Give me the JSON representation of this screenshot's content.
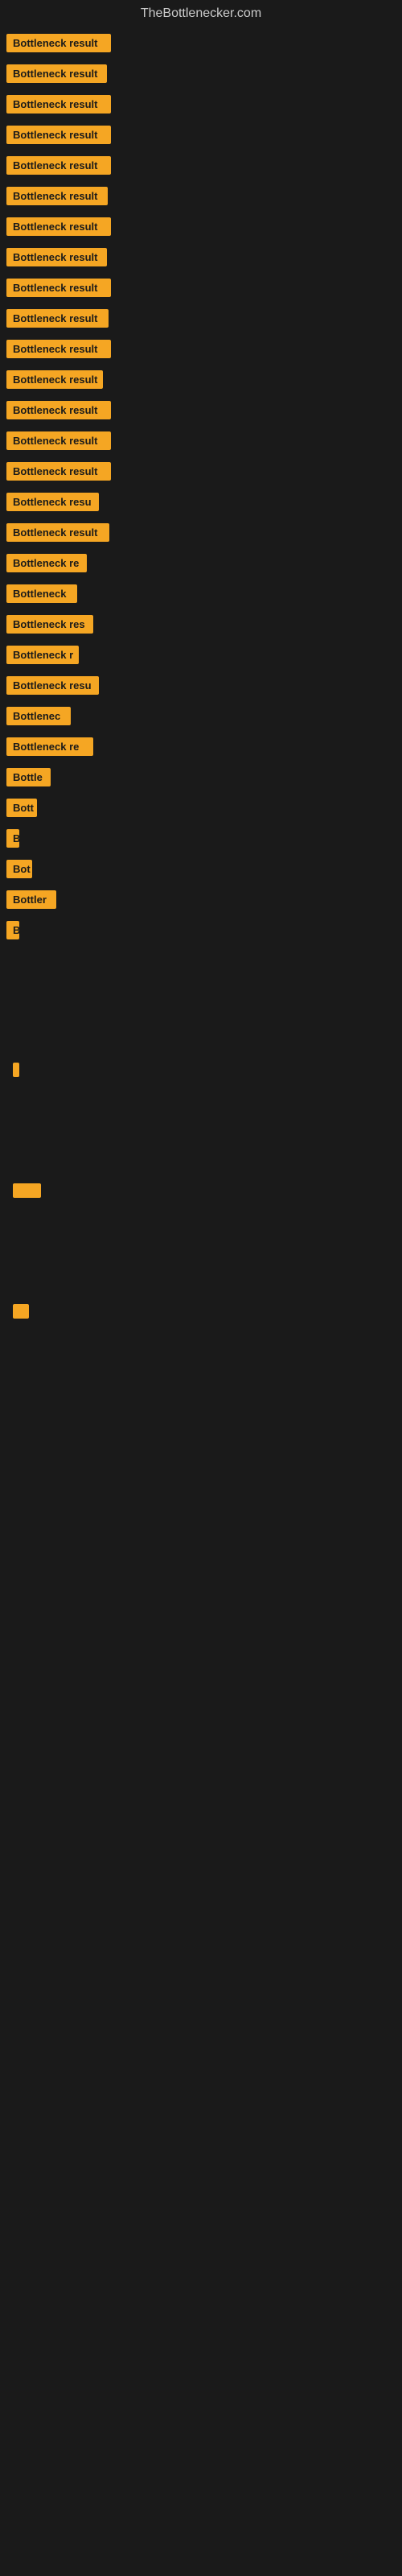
{
  "site": {
    "title": "TheBottlenecker.com"
  },
  "colors": {
    "background": "#1a1a1a",
    "badge": "#f5a623",
    "text": "#cccccc"
  },
  "items": [
    {
      "id": 1,
      "label": "Bottleneck result",
      "width": 130
    },
    {
      "id": 2,
      "label": "Bottleneck result",
      "width": 125
    },
    {
      "id": 3,
      "label": "Bottleneck result",
      "width": 130
    },
    {
      "id": 4,
      "label": "Bottleneck result",
      "width": 130
    },
    {
      "id": 5,
      "label": "Bottleneck result",
      "width": 130
    },
    {
      "id": 6,
      "label": "Bottleneck result",
      "width": 126
    },
    {
      "id": 7,
      "label": "Bottleneck result",
      "width": 130
    },
    {
      "id": 8,
      "label": "Bottleneck result",
      "width": 125
    },
    {
      "id": 9,
      "label": "Bottleneck result",
      "width": 130
    },
    {
      "id": 10,
      "label": "Bottleneck result",
      "width": 127
    },
    {
      "id": 11,
      "label": "Bottleneck result",
      "width": 130
    },
    {
      "id": 12,
      "label": "Bottleneck result",
      "width": 120
    },
    {
      "id": 13,
      "label": "Bottleneck result",
      "width": 130
    },
    {
      "id": 14,
      "label": "Bottleneck result",
      "width": 130
    },
    {
      "id": 15,
      "label": "Bottleneck result",
      "width": 130
    },
    {
      "id": 16,
      "label": "Bottleneck resu",
      "width": 115
    },
    {
      "id": 17,
      "label": "Bottleneck result",
      "width": 128
    },
    {
      "id": 18,
      "label": "Bottleneck re",
      "width": 105
    },
    {
      "id": 19,
      "label": "Bottleneck",
      "width": 97
    },
    {
      "id": 20,
      "label": "Bottleneck res",
      "width": 108
    },
    {
      "id": 21,
      "label": "Bottleneck r",
      "width": 95
    },
    {
      "id": 22,
      "label": "Bottleneck resu",
      "width": 115
    },
    {
      "id": 23,
      "label": "Bottlenec",
      "width": 88
    },
    {
      "id": 24,
      "label": "Bottleneck re",
      "width": 75
    },
    {
      "id": 25,
      "label": "Bottle",
      "width": 55
    },
    {
      "id": 26,
      "label": "Bott",
      "width": 42
    },
    {
      "id": 27,
      "label": "B",
      "width": 18
    },
    {
      "id": 28,
      "label": "Bot",
      "width": 35
    },
    {
      "id": 29,
      "label": "Bottler",
      "width": 60
    },
    {
      "id": 30,
      "label": "B",
      "width": 15
    }
  ]
}
